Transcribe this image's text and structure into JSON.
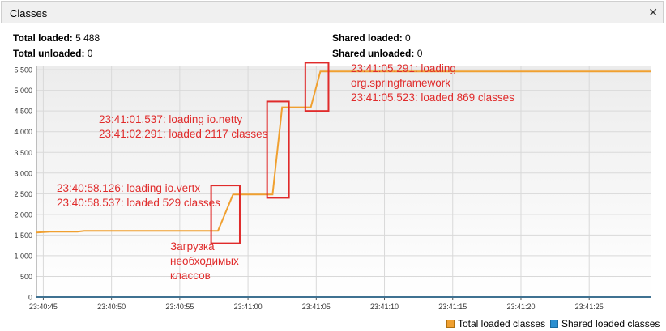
{
  "window": {
    "title": "Classes"
  },
  "stats": {
    "total_loaded_label": "Total loaded:",
    "total_loaded_value": "5 488",
    "total_unloaded_label": "Total unloaded:",
    "total_unloaded_value": "0",
    "shared_loaded_label": "Shared loaded:",
    "shared_loaded_value": "0",
    "shared_unloaded_label": "Shared unloaded:",
    "shared_unloaded_value": "0"
  },
  "legend": {
    "total": "Total loaded classes",
    "shared": "Shared loaded classes"
  },
  "colors": {
    "total": "#f0a030",
    "shared": "#2b8fd0",
    "annotation": "#e02b2b"
  },
  "annotations": {
    "a1_line1": "23:40:58.126: loading io.vertx",
    "a1_line2": "23:40:58.537: loaded 529 classes",
    "a2_line1": "23:41:01.537: loading io.netty",
    "a2_line2": "23:41:02.291: loaded 2117 classes",
    "a3_line1": "23:41:05.291: loading",
    "a3_line2": "org.springframework",
    "a3_line3": "23:41:05.523: loaded 869 classes",
    "ru_line1": "Загрузка",
    "ru_line2": "необходимых",
    "ru_line3": "классов"
  },
  "chart_data": {
    "type": "line",
    "ylim": [
      0,
      5600
    ],
    "yticks": [
      0,
      500,
      1000,
      1500,
      2000,
      2500,
      3000,
      3500,
      4000,
      4500,
      5000,
      5500
    ],
    "ytick_labels": [
      "0",
      "500",
      "1 000",
      "1 500",
      "2 000",
      "2 500",
      "3 000",
      "3 500",
      "4 000",
      "4 500",
      "5 000",
      "5 500"
    ],
    "xlim": [
      "23:40:44.500",
      "23:41:29.500"
    ],
    "xticks": [
      "23:40:45",
      "23:40:50",
      "23:40:55",
      "23:41:00",
      "23:41:05",
      "23:41:10",
      "23:41:15",
      "23:41:20",
      "23:41:25"
    ],
    "series": [
      {
        "name": "Total loaded classes",
        "x": [
          "23:40:44.500",
          "23:40:45.500",
          "23:40:47.500",
          "23:40:48.000",
          "23:40:57.800",
          "23:40:58.900",
          "23:41:01.800",
          "23:41:02.500",
          "23:41:04.600",
          "23:41:05.300",
          "23:41:29.500"
        ],
        "y": [
          1560,
          1580,
          1580,
          1600,
          1600,
          2480,
          2480,
          4590,
          4590,
          5460,
          5460
        ]
      },
      {
        "name": "Shared loaded classes",
        "x": [
          "23:40:44.500",
          "23:41:29.500"
        ],
        "y": [
          0,
          0
        ]
      }
    ]
  }
}
